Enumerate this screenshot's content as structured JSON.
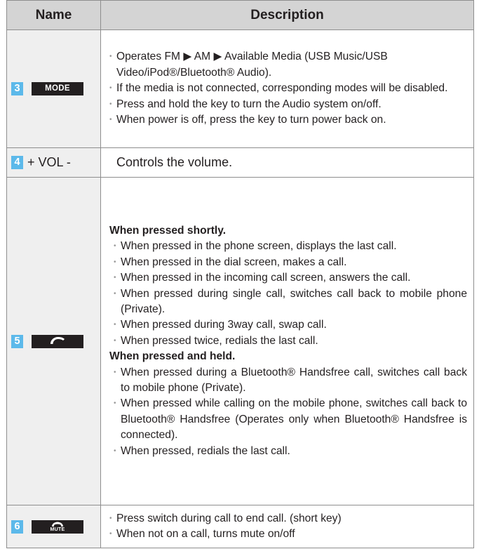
{
  "headers": {
    "name": "Name",
    "description": "Description"
  },
  "rows": [
    {
      "number": "3",
      "key_label": "MODE",
      "items": [
        "Operates FM ▶ AM ▶ Available Media (USB Music/USB Video/iPod®/Bluetooth® Audio).",
        "If the media is not connected, corresponding modes will be disabled.",
        "Press and hold the key to turn the Audio system on/off.",
        "When power is off, press the key to turn power back on."
      ]
    },
    {
      "number": "4",
      "key_label": "+ VOL -",
      "text": "Controls the volume."
    },
    {
      "number": "5",
      "key_icon": "call-icon",
      "section_short": "When pressed shortly.",
      "short_items": [
        "When pressed in the phone screen, displays the last call.",
        "When pressed in the dial screen, makes a call.",
        "When pressed in the incoming call screen, answers the call.",
        "When pressed during single call, switches call back to mobile phone (Private).",
        "When pressed during 3way call, swap call.",
        "When pressed twice, redials the last call."
      ],
      "section_held": "When pressed and held.",
      "held_items": [
        "When pressed during a Bluetooth® Handsfree call, switches call back to mobile phone (Private).",
        "When pressed while calling on the mobile phone, switches call back to Bluetooth® Handsfree (Operates only when Bluetooth® Handsfree is connected).",
        "When pressed, redials the last call."
      ]
    },
    {
      "number": "6",
      "key_icon": "end-call-icon",
      "key_label": "MUTE",
      "items": [
        "Press switch during call to end call. (short key)",
        "When not on a call, turns mute on/off"
      ]
    }
  ],
  "colors": {
    "header_bg": "#d4d4d4",
    "name_cell_bg": "#efefef",
    "badge_bg": "#5cb9ea",
    "key_bg": "#231f20"
  }
}
